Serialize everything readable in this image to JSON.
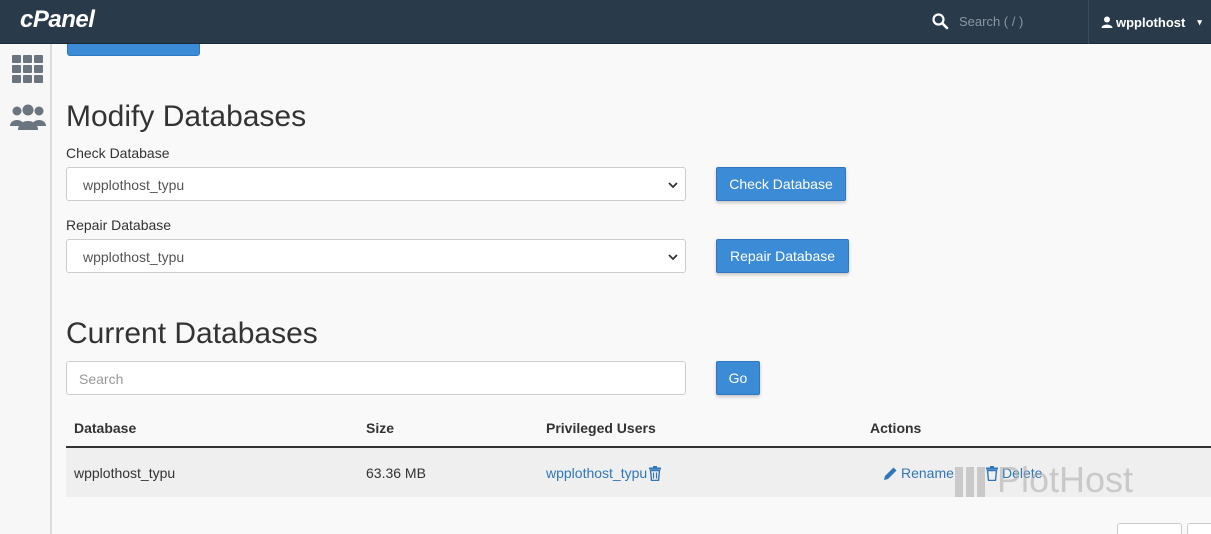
{
  "topbar": {
    "logo": "cPanel",
    "search_placeholder": "Search ( / )",
    "username": "wpplothost",
    "caret": "▾"
  },
  "sidebar": {
    "items": [
      {
        "icon": "grid-icon"
      },
      {
        "icon": "users-icon"
      }
    ]
  },
  "modify": {
    "title": "Modify Databases",
    "check_label": "Check Database",
    "check_value": "wpplothost_typu",
    "check_button": "Check Database",
    "repair_label": "Repair Database",
    "repair_value": "wpplothost_typu",
    "repair_button": "Repair Database"
  },
  "current": {
    "title": "Current Databases",
    "search_placeholder": "Search",
    "go_button": "Go",
    "columns": [
      "Database",
      "Size",
      "Privileged Users",
      "Actions"
    ],
    "rows": [
      {
        "database": "wpplothost_typu",
        "size": "63.36 MB",
        "user": "wpplothost_typu",
        "rename": "Rename",
        "delete": "Delete"
      }
    ]
  },
  "watermark": "PlotHost",
  "colors": {
    "topbar": "#293a4a",
    "primary": "#3b8bd6",
    "link": "#2f77b8"
  }
}
